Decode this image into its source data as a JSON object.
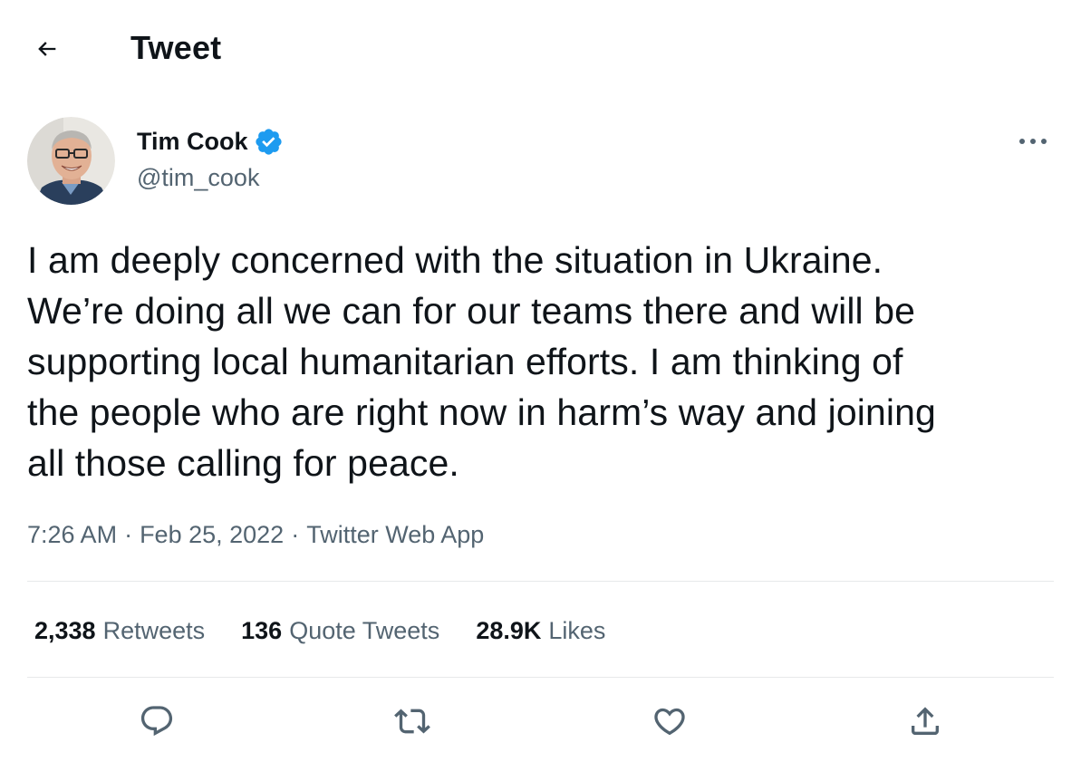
{
  "header": {
    "title": "Tweet",
    "back_icon": "arrow-left-icon"
  },
  "author": {
    "name": "Tim Cook",
    "handle": "@tim_cook",
    "verified_icon": "verified-badge-icon",
    "verified_color": "#1d9bf0"
  },
  "more_icon": "more-horizontal-icon",
  "tweet": {
    "text": "I am deeply concerned with the situation in Ukraine.\nWe’re doing all we can for our teams there and will be\nsupporting local humanitarian efforts. I am thinking of\nthe people who are right now in harm’s way and joining\nall those calling for peace."
  },
  "meta": {
    "time": "7:26 AM",
    "separator": "·",
    "date": "Feb 25, 2022",
    "source": "Twitter Web App"
  },
  "stats": [
    {
      "count": "2,338",
      "label": "Retweets"
    },
    {
      "count": "136",
      "label": "Quote Tweets"
    },
    {
      "count": "28.9K",
      "label": "Likes"
    }
  ],
  "actions": [
    {
      "name": "reply",
      "icon": "reply-icon"
    },
    {
      "name": "retweet",
      "icon": "retweet-icon"
    },
    {
      "name": "like",
      "icon": "heart-icon"
    },
    {
      "name": "share",
      "icon": "share-icon"
    }
  ],
  "colors": {
    "text_primary": "#0f1419",
    "text_secondary": "#536471",
    "divider": "#e7e9ea",
    "accent": "#1d9bf0"
  }
}
